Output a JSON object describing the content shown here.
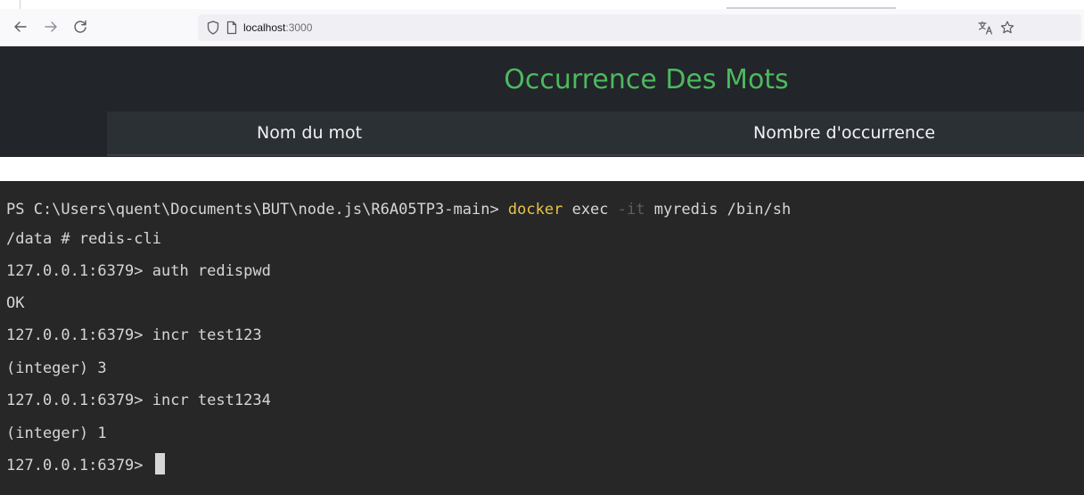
{
  "browser": {
    "url_host": "localhost",
    "url_port": ":3000"
  },
  "page": {
    "title": "Occurrence Des Mots",
    "table_headers": [
      "Nom du mot",
      "Nombre d'occurrence"
    ],
    "colors": {
      "title": "#4cb95f",
      "background": "#222529"
    }
  },
  "terminal": {
    "line1_prefix": "PS C:\\Users\\quent\\Documents\\BUT\\node.js\\R6A05TP3-main> ",
    "line1_cmd": "docker",
    "line1_mid": " exec ",
    "line1_flag": "-it",
    "line1_rest": " myredis /bin/sh",
    "lines": [
      "/data # redis-cli",
      "127.0.0.1:6379> auth redispwd",
      "OK",
      "127.0.0.1:6379> incr test123",
      "(integer) 3",
      "127.0.0.1:6379> incr test1234",
      "(integer) 1"
    ],
    "prompt": "127.0.0.1:6379> "
  }
}
